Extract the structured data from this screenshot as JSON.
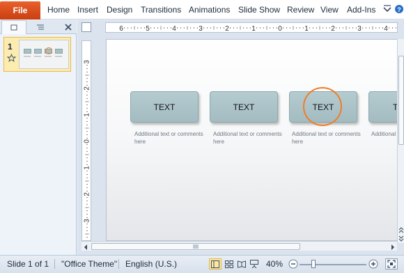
{
  "ribbon": {
    "file_label": "File",
    "tabs": [
      "Home",
      "Insert",
      "Design",
      "Transitions",
      "Animations",
      "Slide Show",
      "Review",
      "View",
      "Add-Ins"
    ]
  },
  "left_pane": {
    "slide_number": "1"
  },
  "ruler": {
    "h_labels": [
      "6",
      "5",
      "4",
      "3",
      "2",
      "1",
      "0",
      "1",
      "2",
      "3",
      "4"
    ],
    "v_labels": [
      "3",
      "2",
      "1",
      "0",
      "1",
      "2",
      "3"
    ]
  },
  "slide": {
    "steps": [
      {
        "label": "TEXT",
        "note": "Additional text or comments here"
      },
      {
        "label": "TEXT",
        "note": "Additional text or comments here"
      },
      {
        "label": "TEXT",
        "note": "Additional text or comments here"
      },
      {
        "label": "TE",
        "note": "Additional"
      }
    ],
    "highlighted_step": 3
  },
  "statusbar": {
    "slide_info": "Slide 1 of 1",
    "theme": "\"Office Theme\"",
    "language": "English (U.S.)",
    "zoom": "40%",
    "zoom_level_fraction": 0.4
  },
  "colors": {
    "file_tab": "#d14d1c",
    "accent_circle": "#f07d25",
    "step_fill": "#a9c1c5"
  }
}
